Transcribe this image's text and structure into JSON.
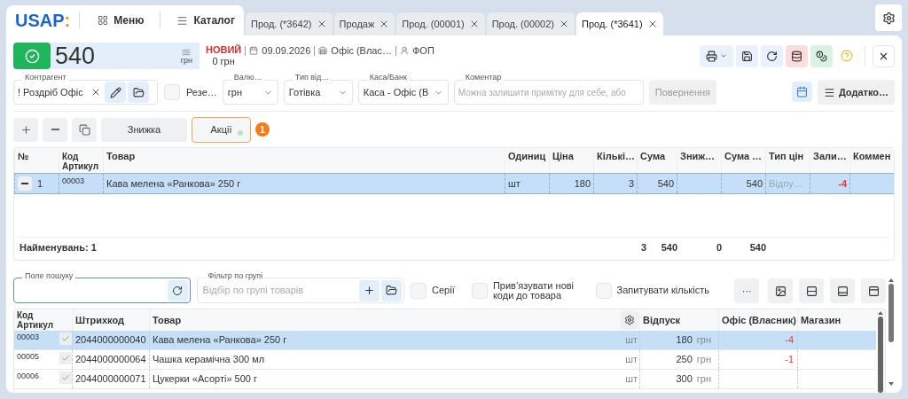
{
  "logo": {
    "text": "USAP",
    "mark": ":"
  },
  "nav": [
    {
      "kind": "grid",
      "label": "Меню"
    },
    {
      "kind": "list",
      "label": "Каталог"
    }
  ],
  "tabs": [
    {
      "label": "Прод. (*3642)",
      "selected": false
    },
    {
      "label": "Продаж",
      "selected": false
    },
    {
      "label": "Прод. (00001)",
      "selected": false
    },
    {
      "label": "Прод. (00002)",
      "selected": false
    },
    {
      "label": "Прод. (*3641)",
      "selected": true
    }
  ],
  "document": {
    "total": "540",
    "currency": "грн",
    "status": "НОВИЙ",
    "paid": "0 грн",
    "date": "09.09.2026",
    "warehouse": "Офіс (Влас…",
    "company": "ФОП"
  },
  "fields": {
    "contractor": {
      "label": "Контрагент",
      "value": "! Роздріб Офіс"
    },
    "reserve": {
      "label": "Резе…",
      "checked": false
    },
    "currency": {
      "label": "Валю…",
      "value": "грн"
    },
    "payment_type": {
      "label": "Тип від…",
      "value": "Готівка"
    },
    "cash": {
      "label": "Каса/Банк",
      "value": "Каса - Офіс (В"
    },
    "comment": {
      "label": "Коментар",
      "placeholder": "Можна залишити примітку для себе, або"
    },
    "return_button": {
      "label": "Повернення",
      "disabled": true
    },
    "more_button": {
      "label": "Додатко…"
    }
  },
  "actions": {
    "discount": "Знижка",
    "promotions": "Акції",
    "promotions_badge": "1"
  },
  "order_table": {
    "columns": [
      "№",
      "Код Артикул",
      "Товар",
      "Одиниц",
      "Ціна",
      "Кількі…",
      "Сума",
      "Зниж…",
      "Сума …",
      "Тип цін",
      "Зали…",
      "Коммен"
    ],
    "rows": [
      {
        "selected": true,
        "number": "1",
        "code": "00003",
        "name": "Кава мелена «Ранкова» 250 г",
        "unit": "шт",
        "price": "180",
        "quantity": "3",
        "sum": "540",
        "total": "540",
        "price_type": "Відпу…",
        "stock": "-4"
      }
    ],
    "footer": {
      "count": "Найменувань: 1",
      "quantity": "3",
      "sum": "540",
      "discount": "0",
      "total": "540"
    }
  },
  "search": {
    "label": "Поле пошуку"
  },
  "group_filter": {
    "label": "Фільтр по групі",
    "placeholder": "Відбір по групі товарів"
  },
  "options": [
    {
      "label": "Серії",
      "checked": false
    },
    {
      "label": "Прив’язувати нові коди до товара",
      "checked": false
    },
    {
      "label": "Запитувати кількість",
      "checked": false
    }
  ],
  "more_actions": "···",
  "products_table": {
    "columns": [
      "Код Артикул",
      "Штрихкод",
      "Товар",
      "Відпуск",
      "Офіс (Власник)",
      "Магазин"
    ],
    "rows": [
      {
        "selected": true,
        "code": "00003",
        "checked": true,
        "barcode": "2044000000040",
        "name": "Кава мелена «Ранкова» 250 г",
        "unit": "шт",
        "price": "180",
        "currency": "грн",
        "stock_office": "-4"
      },
      {
        "selected": false,
        "code": "00005",
        "checked": true,
        "barcode": "2044000000064",
        "name": "Чашка керамічна 300 мл",
        "unit": "шт",
        "price": "250",
        "currency": "грн",
        "stock_office": "-1"
      },
      {
        "selected": false,
        "code": "00006",
        "checked": true,
        "barcode": "2044000000071",
        "name": "Цукерки «Асорті» 500 г",
        "unit": "шт",
        "price": "300",
        "currency": "грн"
      }
    ]
  }
}
